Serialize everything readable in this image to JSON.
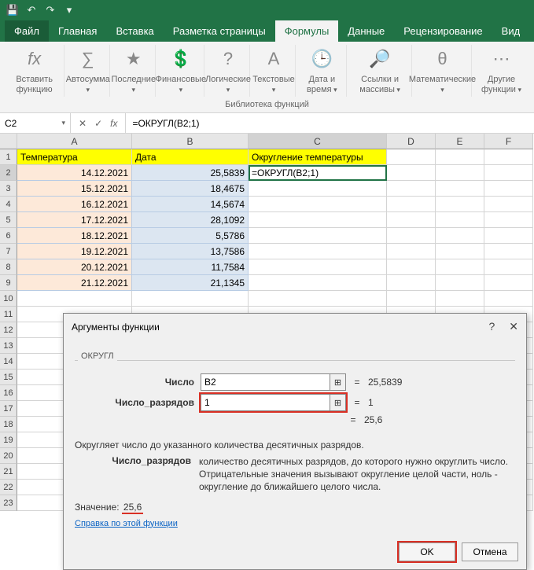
{
  "titlebar": {
    "save": "💾",
    "undo": "↶",
    "redo": "↷"
  },
  "tabs": {
    "file": "Файл",
    "home": "Главная",
    "insert": "Вставка",
    "layout": "Разметка страницы",
    "formulas": "Формулы",
    "data": "Данные",
    "review": "Рецензирование",
    "view": "Вид"
  },
  "ribbon": {
    "insert_fn": "Вставить функцию",
    "autosum": "Автосумма",
    "recent": "Последние",
    "financial": "Финансовые",
    "logical": "Логические",
    "text": "Текстовые",
    "datetime": "Дата и время",
    "lookup": "Ссылки и массивы",
    "math": "Математические",
    "more": "Другие функции",
    "group_caption": "Библиотека функций"
  },
  "formula_bar": {
    "name_box": "C2",
    "formula": "=ОКРУГЛ(B2;1)"
  },
  "columns": [
    "A",
    "B",
    "C",
    "D",
    "E",
    "F"
  ],
  "headers": {
    "a": "Температура",
    "b": "Дата",
    "c": "Округление температуры"
  },
  "active_cell_display": "=ОКРУГЛ(B2;1)",
  "rows": [
    {
      "n": "1"
    },
    {
      "n": "2",
      "a": "14.12.2021",
      "b": "25,5839"
    },
    {
      "n": "3",
      "a": "15.12.2021",
      "b": "18,4675"
    },
    {
      "n": "4",
      "a": "16.12.2021",
      "b": "14,5674"
    },
    {
      "n": "5",
      "a": "17.12.2021",
      "b": "28,1092"
    },
    {
      "n": "6",
      "a": "18.12.2021",
      "b": "5,5786"
    },
    {
      "n": "7",
      "a": "19.12.2021",
      "b": "13,7586"
    },
    {
      "n": "8",
      "a": "20.12.2021",
      "b": "11,7584"
    },
    {
      "n": "9",
      "a": "21.12.2021",
      "b": "21,1345"
    },
    {
      "n": "10"
    },
    {
      "n": "11"
    },
    {
      "n": "12"
    },
    {
      "n": "13"
    },
    {
      "n": "14"
    },
    {
      "n": "15"
    },
    {
      "n": "16"
    },
    {
      "n": "17"
    },
    {
      "n": "18"
    },
    {
      "n": "19"
    },
    {
      "n": "20"
    },
    {
      "n": "21"
    },
    {
      "n": "22"
    },
    {
      "n": "23"
    }
  ],
  "dialog": {
    "title": "Аргументы функции",
    "help_q": "?",
    "close_x": "✕",
    "fn_name": "ОКРУГЛ",
    "arg1_label": "Число",
    "arg1_value": "B2",
    "arg1_eval": "25,5839",
    "arg2_label": "Число_разрядов",
    "arg2_value": "1",
    "arg2_eval": "1",
    "result_preview": "25,6",
    "eq": "=",
    "desc": "Округляет число до указанного количества десятичных разрядов.",
    "param_label": "Число_разрядов",
    "param_text": "количество десятичных разрядов, до которого нужно округлить число. Отрицательные значения вызывают округление целой части, ноль - округление до ближайшего целого числа.",
    "result_label": "Значение:",
    "result_value": "25,6",
    "help_link": "Справка по этой функции",
    "ok": "OK",
    "cancel": "Отмена"
  }
}
